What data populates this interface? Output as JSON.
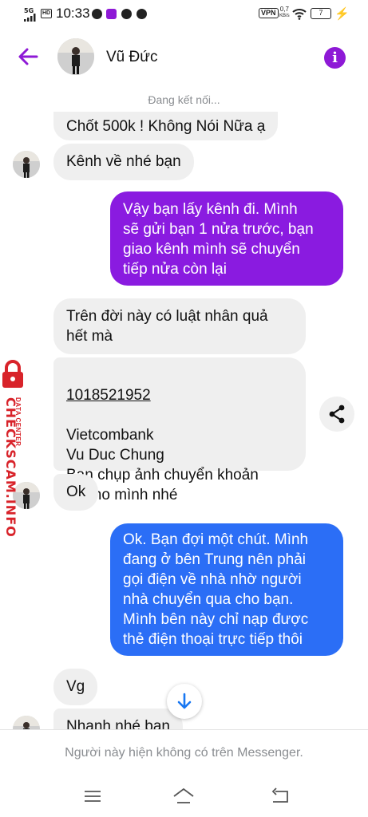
{
  "status_bar": {
    "network": "5G",
    "hd": "HD",
    "time": "10:33",
    "vpn": "VPN",
    "speed_value": "0,7",
    "speed_unit": "KB/s",
    "battery": "7"
  },
  "header": {
    "contact_name": "Vũ Đức",
    "info_label": "i",
    "connecting_status": "Đang kết nối..."
  },
  "messages": [
    {
      "sender": "contact",
      "text": "Chốt 500k ! Không Nói Nữa ạ"
    },
    {
      "sender": "contact",
      "text": "Kênh về nhé bạn"
    },
    {
      "sender": "me",
      "text": "Vậy bạn lấy kênh đi. Mình\nsẽ gửi bạn 1 nửa trước, bạn\ngiao kênh mình sẽ chuyển\ntiếp nửa còn lại"
    },
    {
      "sender": "contact",
      "text": "Trên đời này có luật nhân quả\nhết mà"
    },
    {
      "sender": "contact",
      "account_number": "1018521952",
      "text": "Vietcombank\nVu Duc Chung\nBạn chụp ảnh chuyển khoản\nlại cho mình nhé"
    },
    {
      "sender": "contact",
      "text": "Ok"
    },
    {
      "sender": "me",
      "text": "Ok. Bạn đợi một chút. Mình\nđang ở bên Trung nên phải\ngọi điện về nhà nhờ người\nnhà chuyển qua cho bạn.\nMình bên này chỉ nạp được\nthẻ điện thoại trực tiếp thôi"
    },
    {
      "sender": "contact",
      "text": "Vg"
    },
    {
      "sender": "contact",
      "text": "Nhanh nhé bạn"
    }
  ],
  "footer": {
    "unavailable_text": "Người này hiện không có trên Messenger."
  },
  "watermark": {
    "top_line": "DATA CENTER",
    "brand": "CHECKSCAM.INFO"
  },
  "icons": {
    "back": "back-arrow-icon",
    "info": "info-icon",
    "share": "share-icon",
    "scroll_down": "arrow-down-icon",
    "nav_menu": "menu-icon",
    "nav_home": "home-icon",
    "nav_back": "back-icon"
  },
  "colors": {
    "accent": "#8e19d6",
    "outgoing_purple": "#8a1be0",
    "outgoing_blue": "#2b6ef6",
    "incoming_bubble": "#efefef",
    "watermark_red": "#d8232a"
  }
}
